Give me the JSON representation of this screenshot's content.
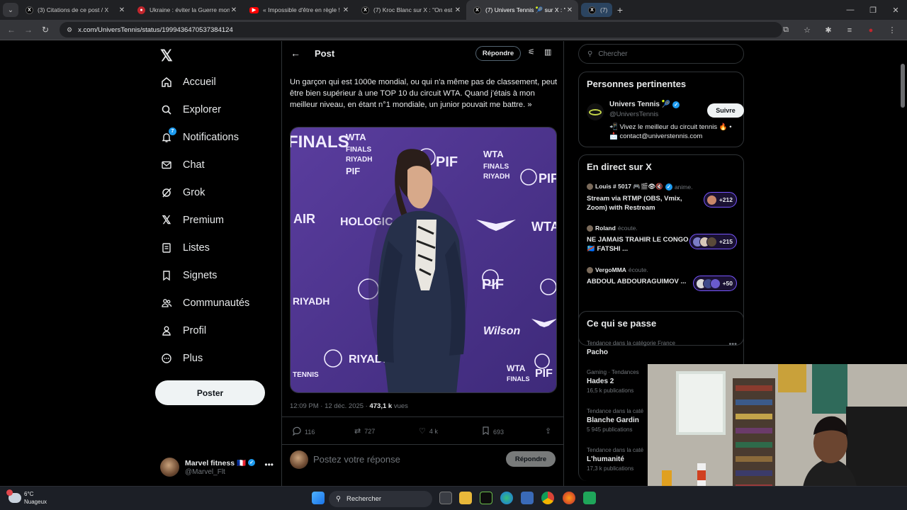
{
  "browser": {
    "tabs": [
      {
        "title": "(3) Citations de ce post / X",
        "fav": "x-icon"
      },
      {
        "title": "Ukraine : éviter la Guerre mondi",
        "fav": "news-icon"
      },
      {
        "title": "« Impossible d'être en règle ! »",
        "fav": "youtube-icon"
      },
      {
        "title": "(7) Kroc Blanc sur X : \"On est vi",
        "fav": "x-icon"
      },
      {
        "title": "(7) Univers Tennis 🎾 sur X : \"«",
        "fav": "x-icon"
      },
      {
        "title": "(7) R",
        "fav": "x-icon"
      }
    ],
    "url": "x.com/UniversTennis/status/1999436470537384124"
  },
  "sidebar": {
    "nav": [
      {
        "label": "Accueil",
        "icon": "home-icon"
      },
      {
        "label": "Explorer",
        "icon": "search-icon"
      },
      {
        "label": "Notifications",
        "icon": "bell-icon",
        "badge": "7"
      },
      {
        "label": "Chat",
        "icon": "mail-icon"
      },
      {
        "label": "Grok",
        "icon": "grok-icon"
      },
      {
        "label": "Premium",
        "icon": "x-icon"
      },
      {
        "label": "Listes",
        "icon": "list-icon"
      },
      {
        "label": "Signets",
        "icon": "bookmark-icon"
      },
      {
        "label": "Communautés",
        "icon": "communities-icon"
      },
      {
        "label": "Profil",
        "icon": "person-icon"
      },
      {
        "label": "Plus",
        "icon": "more-circle-icon"
      }
    ],
    "post_label": "Poster",
    "account": {
      "name": "Marvel fitness 🇫🇷",
      "handle": "@Marvel_Flt"
    }
  },
  "main": {
    "title": "Post",
    "reply_pill": "Répondre",
    "text": "Un garçon qui est 1000e mondial, ou qui n'a même pas de classement, peut être bien supérieur à une TOP 10 du circuit WTA. Quand j'étais à mon meilleur niveau, en étant n°1 mondiale, un junior pouvait me battre. »",
    "time": "12:09 PM · 12 déc. 2025 · ",
    "views_count": "473,1 k",
    "views_label": " vues",
    "media_words": {
      "wta": "WTA",
      "finals": "FINALS",
      "riyadh": "RIYADH",
      "pif": "PIF",
      "hologic": "HOLOGIC",
      "air": "AIR",
      "wilson": "Wilson",
      "tennis": "TENNIS"
    },
    "actions": {
      "replies": "116",
      "reposts": "727",
      "likes": "4 k",
      "bookmarks": "693"
    },
    "reply_placeholder": "Postez votre réponse",
    "reply_button": "Répondre"
  },
  "right": {
    "search_placeholder": "Chercher",
    "relevant": {
      "title": "Personnes pertinentes",
      "name": "Univers Tennis 🎾",
      "handle": "@UniversTennis",
      "bio": "📲 Vivez le meilleur du circuit tennis 🔥 • 📩 contact@universtennis.com",
      "follow": "Suivre"
    },
    "live": {
      "title": "En direct sur X",
      "items": [
        {
          "host": "Louis # 5017 🎮🎬👁🔇",
          "action": "anime.",
          "title": "Stream via RTMP (OBS, Vmix, Zoom) with Restream",
          "count": "+212"
        },
        {
          "host": "Roland",
          "action": "écoute.",
          "title": "NE JAMAIS TRAHIR LE CONGO 🇨🇩 FATSHI ...",
          "count": "+215"
        },
        {
          "host": "VergoMMA",
          "action": "écoute.",
          "title": "ABDOUL ABDOURAGUIMOV ...",
          "count": "+50"
        }
      ]
    },
    "trends": {
      "title": "Ce qui se passe",
      "items": [
        {
          "context": "Tendance dans la catégorie France",
          "name": "Pacho",
          "posts": ""
        },
        {
          "context": "Gaming · Tendances",
          "name": "Hades 2",
          "posts": "16,5 k publications"
        },
        {
          "context": "Tendance dans la caté",
          "name": "Blanche Gardin",
          "posts": "5 945 publications"
        },
        {
          "context": "Tendance dans la caté",
          "name": "L'humanité",
          "posts": "17,3 k publications"
        }
      ]
    }
  },
  "taskbar": {
    "temp": "6°C",
    "condition": "Nuageux",
    "search": "Rechercher"
  }
}
